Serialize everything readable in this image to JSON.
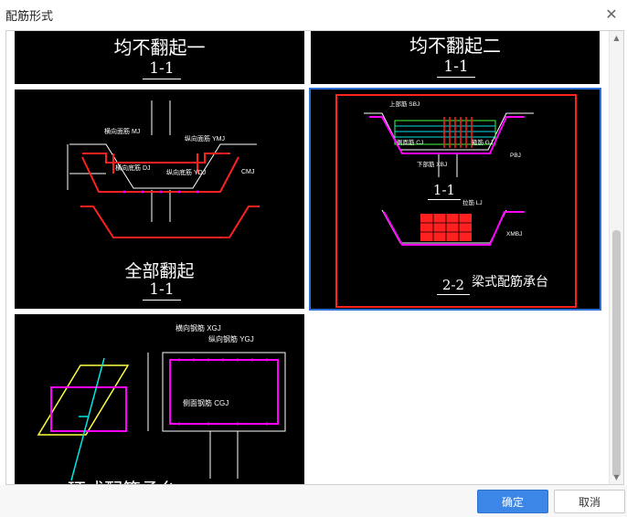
{
  "window": {
    "title": "配筋形式",
    "close_glyph": "✕"
  },
  "options": [
    {
      "title": "均不翻起一",
      "section": "1-1"
    },
    {
      "title": "均不翻起二",
      "section": "1-1"
    },
    {
      "title": "全部翻起",
      "section": "1-1"
    },
    {
      "title": "梁式配筋承台",
      "section_top": "1-1",
      "section_bottom": "2-2",
      "selected": true,
      "annotations": [
        "上部筋 SBJ",
        "下部筋 XBJ",
        "侧面筋 CJ",
        "箍筋 GJ",
        "拉筋 LJ",
        "PBJ",
        "XMBJ"
      ]
    },
    {
      "title": "环式配筋承台",
      "annotations": [
        "横向钢筋 XGJ",
        "纵向钢筋 YGJ",
        "侧面钢筋 CGJ"
      ]
    }
  ],
  "full_turn_annotations": [
    "横向面筋 MJ",
    "纵向面筋 YMJ",
    "横向底筋 DJ",
    "纵向底筋 YDJ",
    "CMJ"
  ],
  "buttons": {
    "ok": "确定",
    "cancel": "取消"
  },
  "colors": {
    "accent": "#3b86e7",
    "selection_red": "#ff2020",
    "selection_blue": "#2b6fd6",
    "drawing_red": "#ff2020",
    "drawing_magenta": "#ff00ff",
    "drawing_green": "#40ff40",
    "drawing_cyan": "#00e5e5",
    "drawing_yellow": "#ffff40"
  }
}
